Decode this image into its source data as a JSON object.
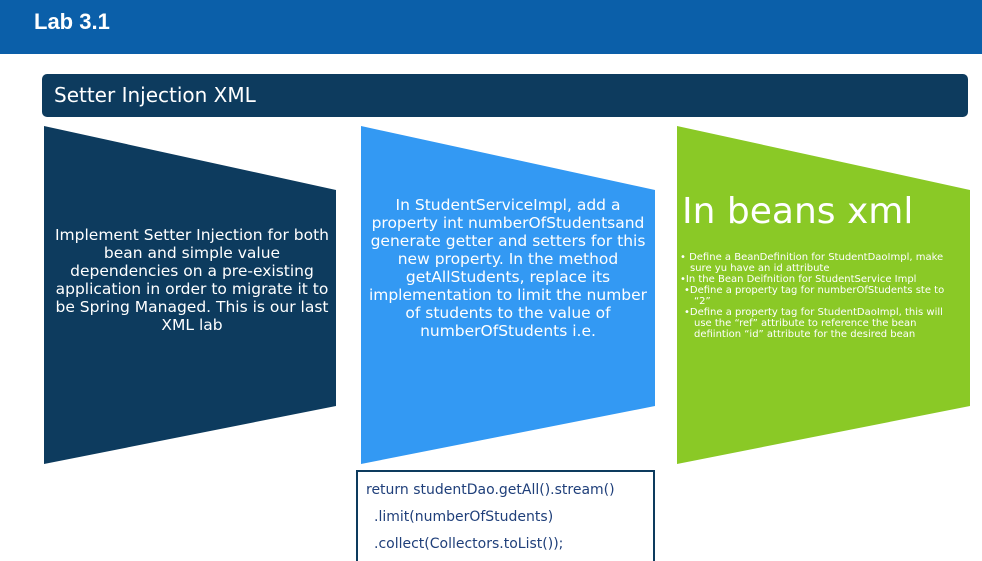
{
  "header": {
    "title": "Lab 3.1"
  },
  "section": {
    "title": "Setter Injection XML"
  },
  "panels": {
    "left": {
      "text": "Implement Setter Injection for both bean and simple value dependencies on a pre-existing application in order to migrate it to be Spring Managed. This is our last XML lab"
    },
    "middle": {
      "text": "In StudentServiceImpl, add a property int numberOfStudentsand generate getter and setters for this new property. In the method getAllStudents, replace its implementation to limit the number of students to the value of numberOfStudents i.e."
    },
    "right": {
      "heading": "In beans xml",
      "items": [
        "• Define a BeanDefinition for StudentDaoImpl, make sure yu have an id attribute",
        "•In the Bean Deifnition for StudentService Impl",
        "•Define a property tag for numberOfStudents ste to “2”",
        "•Define a property tag for StudentDaoImpl, this will use the “ref” attribute to reference the bean defiintion “id” attribute for the desired bean"
      ]
    }
  },
  "code": {
    "lines": [
      "return studentDao.getAll().stream()",
      ".limit(numberOfStudents)",
      ".collect(Collectors.toList());"
    ]
  },
  "colors": {
    "header": "#0b5fa9",
    "dark_navy": "#0d3b5e",
    "blue": "#3399f3",
    "green": "#8ac926"
  }
}
